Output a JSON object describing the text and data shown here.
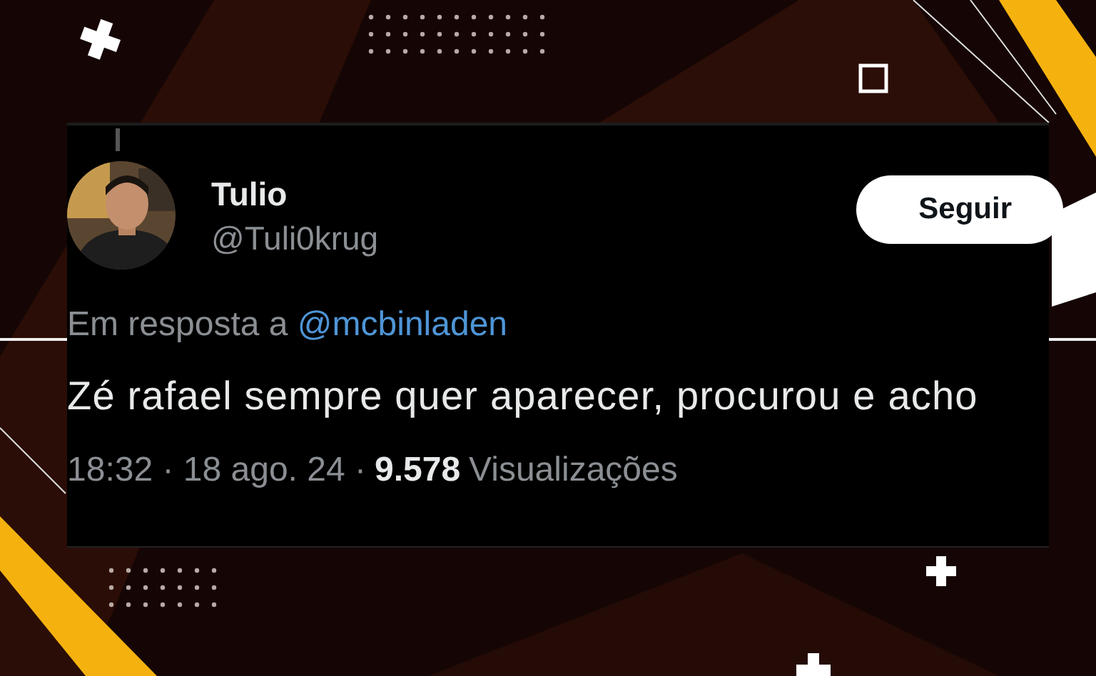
{
  "tweet": {
    "author": {
      "name": "Tulio",
      "handle": "@Tuli0krug"
    },
    "follow_button": "Seguir",
    "reply_to": {
      "prefix": "Em resposta a",
      "handle": "@mcbinladen"
    },
    "text": "Zé rafael sempre quer aparecer, procurou e acho",
    "meta": {
      "time_date": "18:32 · 18 ago. 24 ·",
      "views": "9.578",
      "views_label": "Visualizações"
    }
  }
}
